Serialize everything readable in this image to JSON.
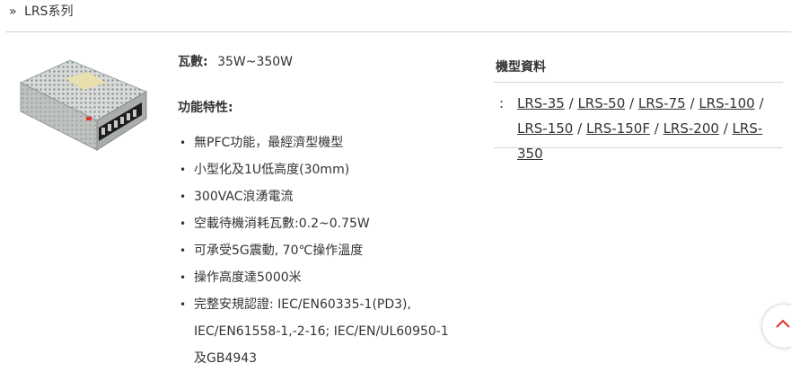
{
  "breadcrumb": {
    "chevron": "»",
    "label": "LRS系列"
  },
  "wattage": {
    "label": "瓦數:",
    "value": "35W~350W"
  },
  "features": {
    "title": "功能特性:",
    "items": [
      "無PFC功能，最經濟型機型",
      "小型化及1U低高度(30mm)",
      "300VAC浪湧電流",
      "空載待機消耗瓦數:0.2~0.75W",
      "可承受5G震動, 70℃操作溫度",
      "操作高度達5000米",
      "完整安規認證: IEC/EN60335-1(PD3),",
      "IEC/EN61558-1,-2-16; IEC/EN/UL60950-1",
      "及GB4943"
    ]
  },
  "models": {
    "title": "機型資料",
    "colon": ":",
    "separator": "/",
    "items": [
      "LRS-35",
      "LRS-50",
      "LRS-75",
      "LRS-100",
      "LRS-150",
      "LRS-150F",
      "LRS-200",
      "LRS-350"
    ]
  },
  "icons": {
    "chevron": "chevron-right-icon",
    "scroll_top": "chevron-up-icon"
  },
  "colors": {
    "accent": "#e0312b",
    "rule": "#cfcfcf",
    "text": "#333333"
  }
}
